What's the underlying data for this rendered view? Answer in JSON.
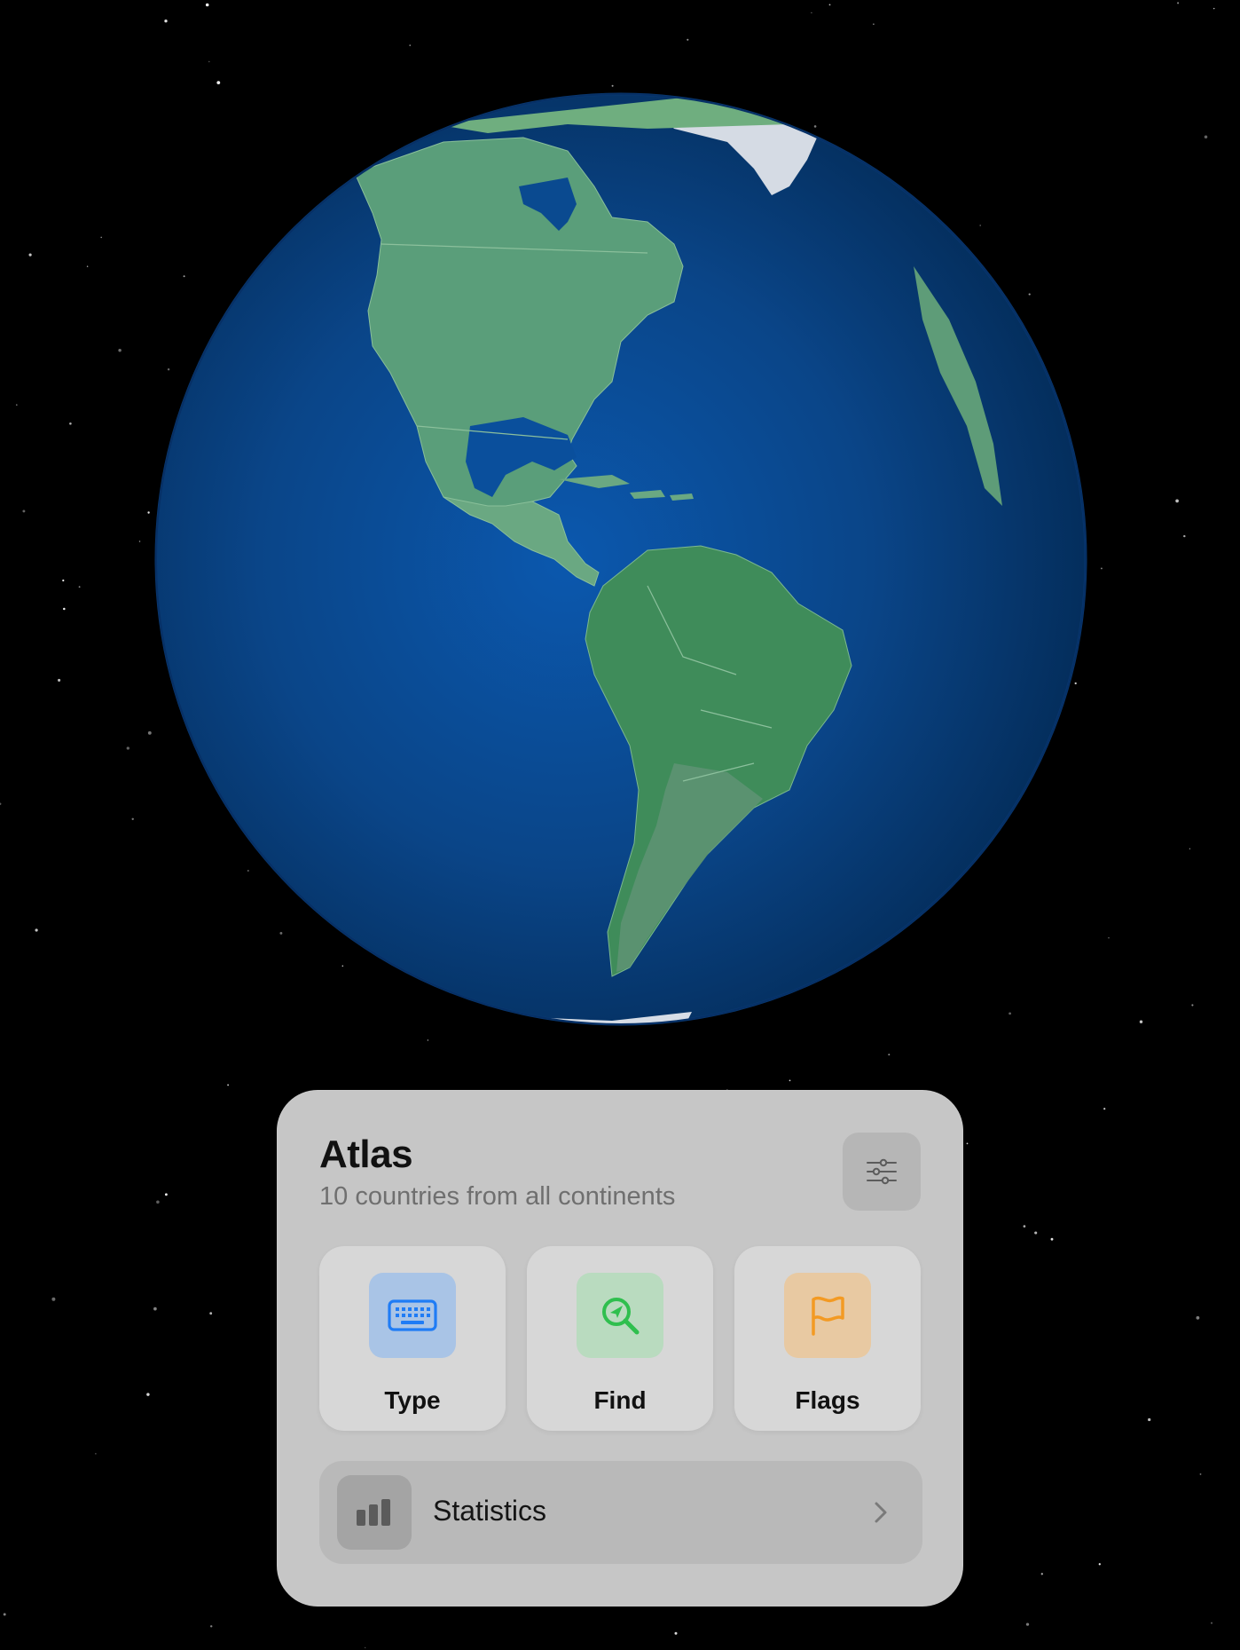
{
  "scene": {
    "background": "#000000",
    "globe": {
      "ocean_color": "#0a4f9c",
      "land_color": "#5a9e7a",
      "highlight_color": "#3c8a55",
      "ice_color": "#d7dde6"
    }
  },
  "panel": {
    "title": "Atlas",
    "subtitle": "10 countries from all continents",
    "settings_icon": "sliders-icon",
    "modes": [
      {
        "label": "Type",
        "icon": "keyboard-icon",
        "color": "#1f7cf5",
        "bg": "#a9c4e6"
      },
      {
        "label": "Find",
        "icon": "magnifier-location-icon",
        "color": "#2fbf4e",
        "bg": "#b9dbbf"
      },
      {
        "label": "Flags",
        "icon": "flag-icon",
        "color": "#f39a23",
        "bg": "#e8c9a2"
      }
    ],
    "statistics": {
      "label": "Statistics",
      "icon": "bar-chart-icon",
      "chevron": "chevron-right-icon"
    }
  }
}
